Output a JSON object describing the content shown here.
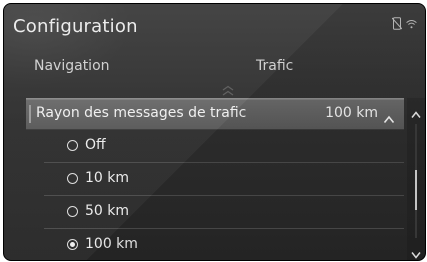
{
  "header": {
    "title": "Configuration"
  },
  "status": {
    "icons": [
      "phone-off-icon",
      "wifi-icon"
    ]
  },
  "tabs": [
    {
      "label": "Navigation"
    },
    {
      "label": "Trafic"
    }
  ],
  "setting": {
    "label": "Rayon des messages de trafic",
    "value": "100 km"
  },
  "options": [
    {
      "label": "Off",
      "selected": false
    },
    {
      "label": "10 km",
      "selected": false
    },
    {
      "label": "50 km",
      "selected": false
    },
    {
      "label": "100 km",
      "selected": true
    }
  ],
  "scroll": {
    "position_fraction": 0.62,
    "visible_fraction": 0.35
  }
}
